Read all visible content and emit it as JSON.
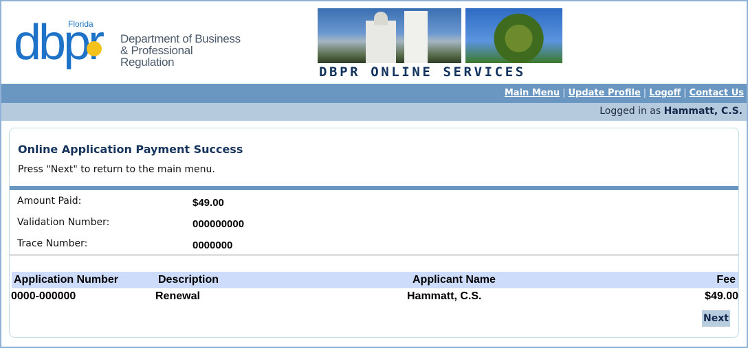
{
  "header": {
    "logo_state": "Florida",
    "logo_acronym": "dbpr",
    "logo_dept_line1": "Department of Business",
    "logo_dept_line2": "& Professional Regulation",
    "banner_title": "DBPR ONLINE SERVICES"
  },
  "nav": {
    "items": [
      {
        "label": "Main Menu"
      },
      {
        "label": "Update Profile"
      },
      {
        "label": "Logoff"
      },
      {
        "label": "Contact Us"
      }
    ],
    "separator": "|"
  },
  "user": {
    "prefix": "Logged in as",
    "name": "Hammatt, C.S."
  },
  "panel": {
    "title": "Online Application Payment Success",
    "subtitle": "Press \"Next\" to return to the main menu.",
    "fields": [
      {
        "label": "Amount Paid:",
        "value": "$49.00"
      },
      {
        "label": "Validation Number:",
        "value": "000000000"
      },
      {
        "label": "Trace Number:",
        "value": "0000000"
      }
    ],
    "table": {
      "headers": [
        "Application Number",
        "Description",
        "Applicant Name",
        "Fee"
      ],
      "rows": [
        [
          "0000-000000",
          "Renewal",
          "Hammatt, C.S.",
          "$49.00"
        ]
      ]
    },
    "next_label": "Next"
  },
  "colors": {
    "nav_bar": "#6a97c1",
    "user_bar": "#b6cade",
    "table_header": "#ccdcfa",
    "title_text": "#16335c",
    "logo_blue": "#1e73c8"
  }
}
